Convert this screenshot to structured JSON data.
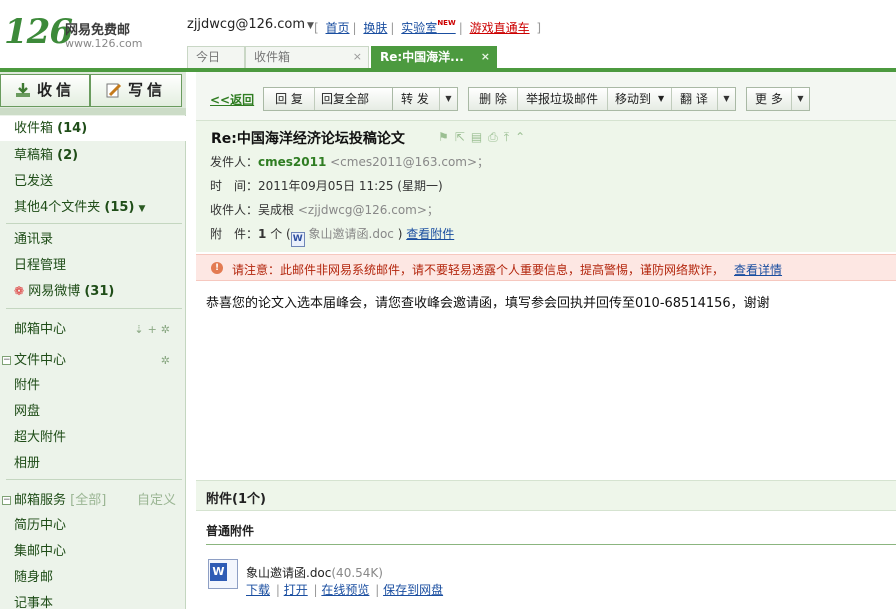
{
  "brand": {
    "logo_num": "126",
    "name": "网易免费邮",
    "url": "www.126.com"
  },
  "account": {
    "email": "zjjdwcg@126.com"
  },
  "toplinks": {
    "home": "首页",
    "skin": "换肤",
    "lab": "实验室",
    "lab_badge": "NEW",
    "game": "游戏直通车"
  },
  "tabs": [
    {
      "label": "今日",
      "active": false
    },
    {
      "label": "收件箱",
      "active": false,
      "close": "×"
    },
    {
      "label": "Re:中国海洋...",
      "active": true,
      "close": "×"
    }
  ],
  "sidebar": {
    "receive_label": "收信",
    "compose_label": "写信",
    "folders": [
      {
        "label": "收件箱",
        "count": "(14)"
      },
      {
        "label": "草稿箱",
        "count": "(2)"
      },
      {
        "label": "已发送",
        "count": ""
      },
      {
        "label": "其他4个文件夹",
        "count": "(15)"
      }
    ],
    "apps": [
      {
        "label": "通讯录"
      },
      {
        "label": "日程管理"
      },
      {
        "label": "网易微博",
        "count": "(31)"
      }
    ],
    "mailbox_center": "邮箱中心",
    "file_center": "文件中心",
    "file_items": [
      "附件",
      "网盘",
      "超大附件",
      "相册"
    ],
    "mail_service": "邮箱服务",
    "mail_service_all": "[全部]",
    "mail_service_custom": "自定义",
    "service_items": [
      "简历中心",
      "集邮中心",
      "随身邮",
      "记事本"
    ]
  },
  "toolbar": {
    "back": "<<返回",
    "reply": "回 复",
    "reply_all": "回复全部",
    "forward": "转 发",
    "delete": "删 除",
    "report_spam": "举报垃圾邮件",
    "move_to": "移动到",
    "translate": "翻 译",
    "more": "更 多"
  },
  "mail": {
    "subject": "Re:中国海洋经济论坛投稿论文",
    "from_key": "发件人：",
    "from_name": "cmes2011",
    "from_addr": "<cmes2011@163.com>；",
    "time_key": "时　间：",
    "time_val": "2011年09月05日 11:25 (星期一)",
    "to_key": "收件人：",
    "to_name": "吴成根",
    "to_addr": "<zjjdwcg@126.com>；",
    "attach_key": "附　件：",
    "attach_count": "1",
    "attach_unit": "个 (",
    "attach_file": "象山邀请函.doc",
    "attach_close": ")",
    "attach_view": "查看附件",
    "warning": "请注意：此邮件非网易系统邮件，请不要轻易透露个人重要信息，提高警惕，谨防网络欺诈，",
    "warning_link": "查看详情",
    "body": "恭喜您的论文入选本届峰会，请您查收峰会邀请函，填写参会回执并回传至010-68514156，谢谢"
  },
  "attachments": {
    "title": "附件(1个)",
    "section": "普通附件",
    "file_name": "象山邀请函.doc",
    "file_size": "(40.54K)",
    "actions": [
      "下载",
      "打开",
      "在线预览",
      "保存到网盘"
    ]
  }
}
